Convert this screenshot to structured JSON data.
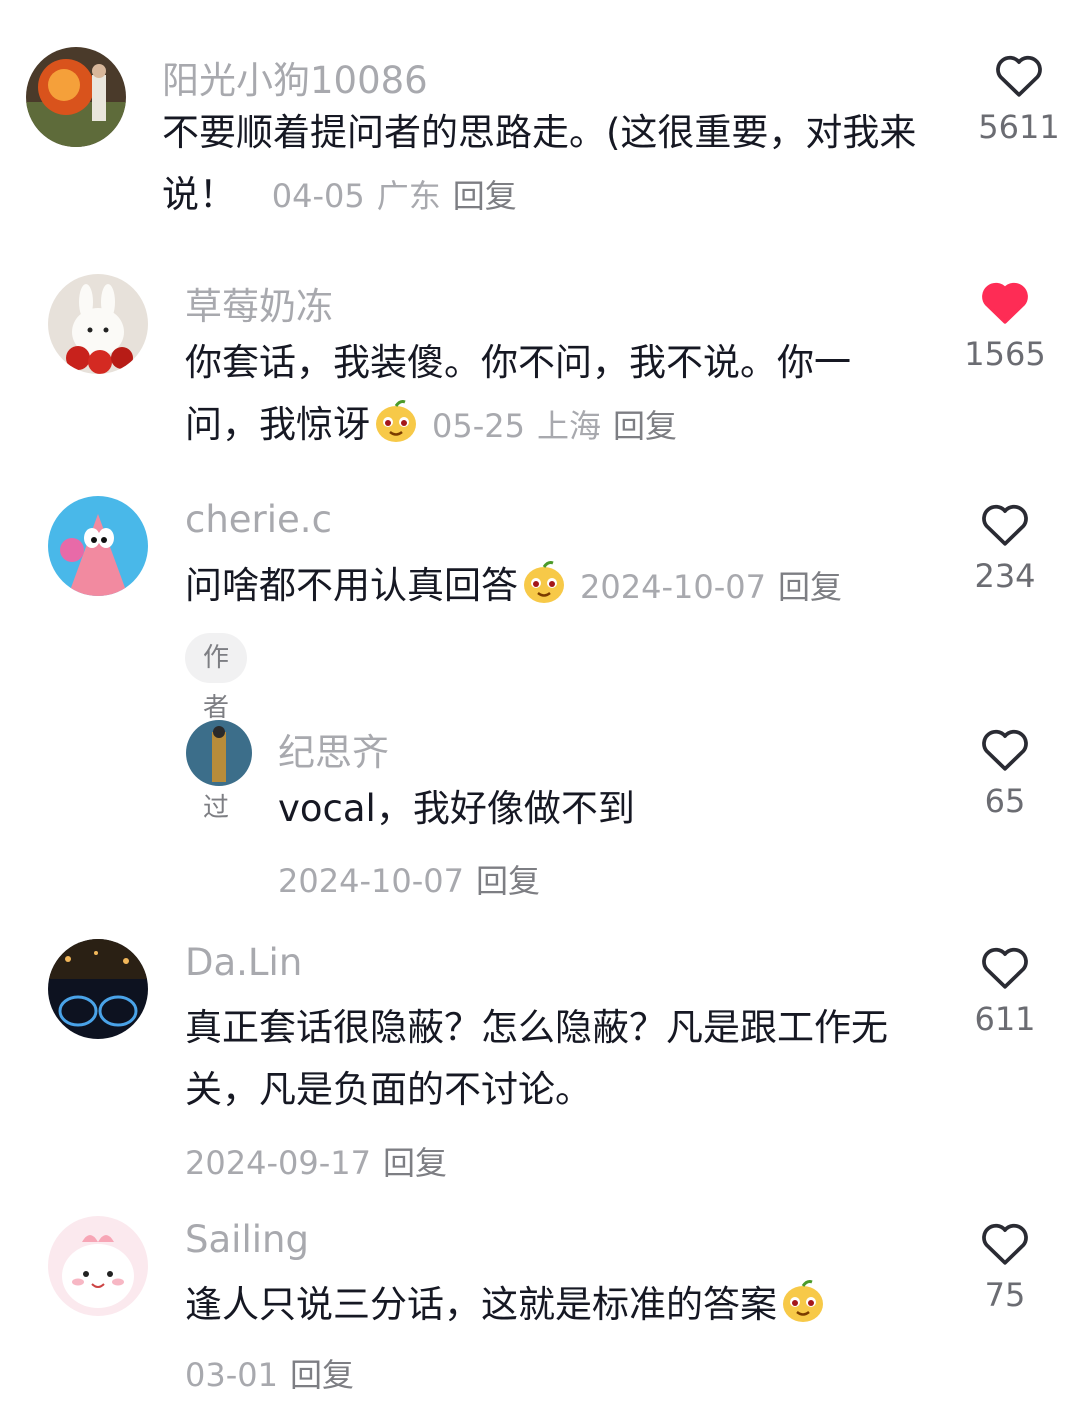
{
  "comments": [
    {
      "username": "阳光小狗10086",
      "text": "不要顺着提问者的思路走。(这很重要，对我来说！",
      "date": "04-05",
      "location": "广东",
      "reply": "回复",
      "likes": "5611",
      "liked": false
    },
    {
      "username": "草莓奶冻",
      "text": "你套话，我装傻。你不问，我不说。你一问，我惊讶",
      "date": "05-25",
      "location": "上海",
      "reply": "回复",
      "likes": "1565",
      "liked": true
    },
    {
      "username": "cherie.c",
      "text": "问啥都不用认真回答",
      "date": "2024-10-07",
      "reply": "回复",
      "likes": "234",
      "liked": false,
      "badge": "作者赞过",
      "sub_reply": {
        "username": "纪思齐",
        "text": "vocal，我好像做不到",
        "date": "2024-10-07",
        "reply": "回复",
        "likes": "65",
        "liked": false
      }
    },
    {
      "username": "Da.Lin",
      "text": "真正套话很隐蔽？怎么隐蔽？凡是跟工作无关，凡是负面的不讨论。",
      "date": "2024-09-17",
      "reply": "回复",
      "likes": "611",
      "liked": false
    },
    {
      "username": "Sailing",
      "text": "逢人只说三分话，这就是标准的答案",
      "date": "03-01",
      "reply": "回复",
      "likes": "75",
      "liked": false
    }
  ],
  "icons": {
    "heart": "heart-icon",
    "emoji": "smirk-emoji-icon"
  },
  "colors": {
    "liked_heart": "#fe2c55",
    "muted_text": "#a8a9ae"
  }
}
